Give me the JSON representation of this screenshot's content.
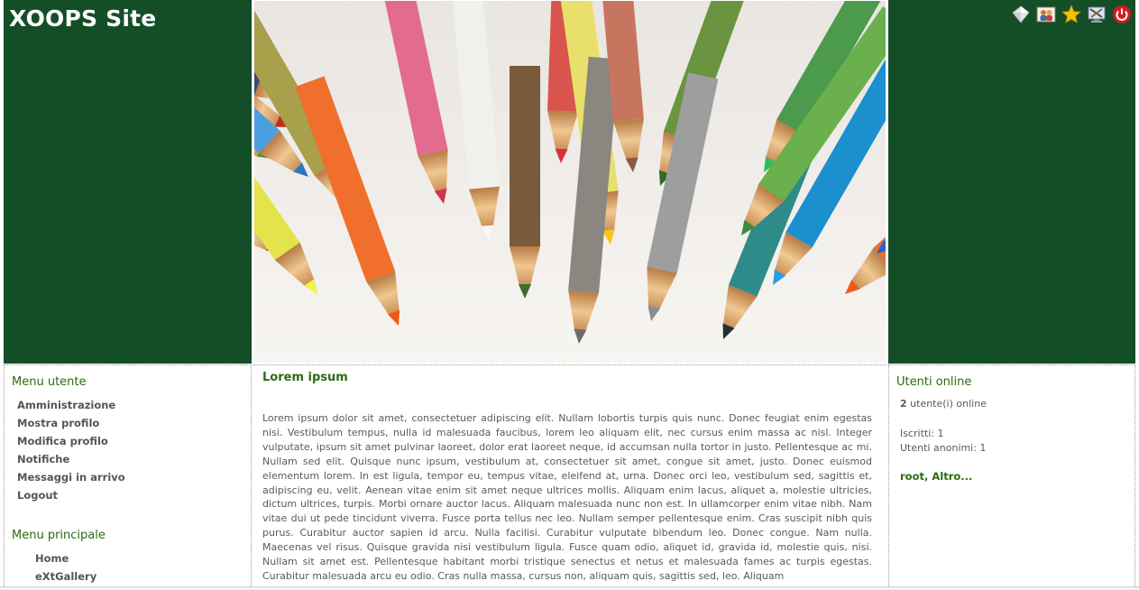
{
  "site": {
    "title": "XOOPS Site"
  },
  "toolbar": {
    "icons": [
      "diamond-icon",
      "users-icon",
      "star-icon",
      "tools-icon",
      "power-icon"
    ],
    "colors": {
      "star": "#f2c200",
      "power": "#d21b1b"
    }
  },
  "colors": {
    "header_bg": "#134e27",
    "accent_green": "#2c6b12"
  },
  "user_menu": {
    "title": "Menu utente",
    "items": [
      "Amministrazione",
      "Mostra profilo",
      "Modifica profilo",
      "Notifiche",
      "Messaggi in arrivo",
      "Logout"
    ]
  },
  "main_menu": {
    "title": "Menu principale",
    "items": [
      "Home",
      "eXtGallery"
    ]
  },
  "content": {
    "title": "Lorem ipsum",
    "body": "Lorem ipsum dolor sit amet, consectetuer adipiscing elit. Nullam lobortis turpis quis nunc. Donec feugiat enim egestas nisi. Vestibulum tempus, nulla id malesuada faucibus, lorem leo aliquam elit, nec cursus enim massa ac nisl. Integer vulputate, ipsum sit amet pulvinar laoreet, dolor erat laoreet neque, id accumsan nulla tortor in justo. Pellentesque ac mi. Nullam sed elit. Quisque nunc ipsum, vestibulum at, consectetuer sit amet, congue sit amet, justo. Donec euismod elementum lorem. In est ligula, tempor eu, tempus vitae, eleifend at, urna. Donec orci leo, vestibulum sed, sagittis et, adipiscing eu, velit. Aenean vitae enim sit amet neque ultrices mollis. Aliquam enim lacus, aliquet a, molestie ultricies, dictum ultrices, turpis. Morbi ornare auctor lacus. Aliquam malesuada nunc non est. In ullamcorper enim vitae nibh. Nam vitae dui ut pede tincidunt viverra. Fusce porta tellus nec leo. Nullam semper pellentesque enim. Cras suscipit nibh quis purus. Curabitur auctor sapien id arcu. Nulla facilisi. Curabitur vulputate bibendum leo. Donec congue. Nam nulla. Maecenas vel risus. Quisque gravida nisi vestibulum ligula. Fusce quam odio, aliquet id, gravida id, molestie quis, nisi. Nullam sit amet est. Pellentesque habitant morbi tristique senectus et netus et malesuada fames ac turpis egestas. Curabitur malesuada arcu eu odio. Cras nulla massa, cursus non, aliquam quis, sagittis sed, leo. Aliquam"
  },
  "online": {
    "title": "Utenti online",
    "count": "2",
    "count_suffix": "utente(i) online",
    "registered": "Iscritti: 1",
    "anonymous": "Utenti anonimi: 1",
    "user_link": "root",
    "separator": ", ",
    "more_link": "Altro..."
  }
}
